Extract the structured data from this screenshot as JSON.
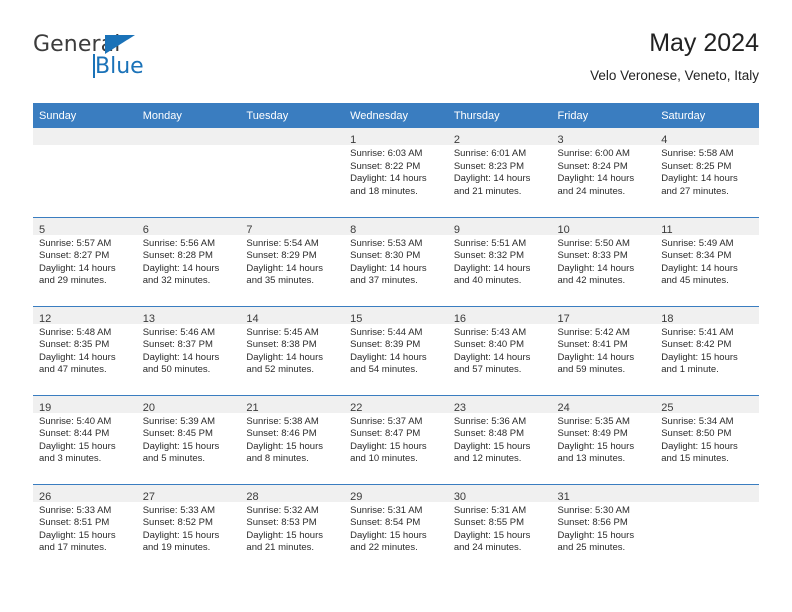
{
  "brand": {
    "name_top": "General",
    "name_bottom": "Blue",
    "accent_color": "#1a72b8"
  },
  "header": {
    "title": "May 2024",
    "subtitle": "Velo Veronese, Veneto, Italy"
  },
  "theme": {
    "header_bar_color": "#3a7dc0",
    "day_band_color": "#f0f0f0",
    "text_color": "#2b2b2b"
  },
  "weekday_headers": [
    "Sunday",
    "Monday",
    "Tuesday",
    "Wednesday",
    "Thursday",
    "Friday",
    "Saturday"
  ],
  "weeks": [
    [
      {
        "day": "",
        "empty": true,
        "sunrise": "",
        "sunset": "",
        "daylight_1": "",
        "daylight_2": ""
      },
      {
        "day": "",
        "empty": true,
        "sunrise": "",
        "sunset": "",
        "daylight_1": "",
        "daylight_2": ""
      },
      {
        "day": "",
        "empty": true,
        "sunrise": "",
        "sunset": "",
        "daylight_1": "",
        "daylight_2": ""
      },
      {
        "day": "1",
        "sunrise": "Sunrise: 6:03 AM",
        "sunset": "Sunset: 8:22 PM",
        "daylight_1": "Daylight: 14 hours",
        "daylight_2": "and 18 minutes."
      },
      {
        "day": "2",
        "sunrise": "Sunrise: 6:01 AM",
        "sunset": "Sunset: 8:23 PM",
        "daylight_1": "Daylight: 14 hours",
        "daylight_2": "and 21 minutes."
      },
      {
        "day": "3",
        "sunrise": "Sunrise: 6:00 AM",
        "sunset": "Sunset: 8:24 PM",
        "daylight_1": "Daylight: 14 hours",
        "daylight_2": "and 24 minutes."
      },
      {
        "day": "4",
        "sunrise": "Sunrise: 5:58 AM",
        "sunset": "Sunset: 8:25 PM",
        "daylight_1": "Daylight: 14 hours",
        "daylight_2": "and 27 minutes."
      }
    ],
    [
      {
        "day": "5",
        "sunrise": "Sunrise: 5:57 AM",
        "sunset": "Sunset: 8:27 PM",
        "daylight_1": "Daylight: 14 hours",
        "daylight_2": "and 29 minutes."
      },
      {
        "day": "6",
        "sunrise": "Sunrise: 5:56 AM",
        "sunset": "Sunset: 8:28 PM",
        "daylight_1": "Daylight: 14 hours",
        "daylight_2": "and 32 minutes."
      },
      {
        "day": "7",
        "sunrise": "Sunrise: 5:54 AM",
        "sunset": "Sunset: 8:29 PM",
        "daylight_1": "Daylight: 14 hours",
        "daylight_2": "and 35 minutes."
      },
      {
        "day": "8",
        "sunrise": "Sunrise: 5:53 AM",
        "sunset": "Sunset: 8:30 PM",
        "daylight_1": "Daylight: 14 hours",
        "daylight_2": "and 37 minutes."
      },
      {
        "day": "9",
        "sunrise": "Sunrise: 5:51 AM",
        "sunset": "Sunset: 8:32 PM",
        "daylight_1": "Daylight: 14 hours",
        "daylight_2": "and 40 minutes."
      },
      {
        "day": "10",
        "sunrise": "Sunrise: 5:50 AM",
        "sunset": "Sunset: 8:33 PM",
        "daylight_1": "Daylight: 14 hours",
        "daylight_2": "and 42 minutes."
      },
      {
        "day": "11",
        "sunrise": "Sunrise: 5:49 AM",
        "sunset": "Sunset: 8:34 PM",
        "daylight_1": "Daylight: 14 hours",
        "daylight_2": "and 45 minutes."
      }
    ],
    [
      {
        "day": "12",
        "sunrise": "Sunrise: 5:48 AM",
        "sunset": "Sunset: 8:35 PM",
        "daylight_1": "Daylight: 14 hours",
        "daylight_2": "and 47 minutes."
      },
      {
        "day": "13",
        "sunrise": "Sunrise: 5:46 AM",
        "sunset": "Sunset: 8:37 PM",
        "daylight_1": "Daylight: 14 hours",
        "daylight_2": "and 50 minutes."
      },
      {
        "day": "14",
        "sunrise": "Sunrise: 5:45 AM",
        "sunset": "Sunset: 8:38 PM",
        "daylight_1": "Daylight: 14 hours",
        "daylight_2": "and 52 minutes."
      },
      {
        "day": "15",
        "sunrise": "Sunrise: 5:44 AM",
        "sunset": "Sunset: 8:39 PM",
        "daylight_1": "Daylight: 14 hours",
        "daylight_2": "and 54 minutes."
      },
      {
        "day": "16",
        "sunrise": "Sunrise: 5:43 AM",
        "sunset": "Sunset: 8:40 PM",
        "daylight_1": "Daylight: 14 hours",
        "daylight_2": "and 57 minutes."
      },
      {
        "day": "17",
        "sunrise": "Sunrise: 5:42 AM",
        "sunset": "Sunset: 8:41 PM",
        "daylight_1": "Daylight: 14 hours",
        "daylight_2": "and 59 minutes."
      },
      {
        "day": "18",
        "sunrise": "Sunrise: 5:41 AM",
        "sunset": "Sunset: 8:42 PM",
        "daylight_1": "Daylight: 15 hours",
        "daylight_2": "and 1 minute."
      }
    ],
    [
      {
        "day": "19",
        "sunrise": "Sunrise: 5:40 AM",
        "sunset": "Sunset: 8:44 PM",
        "daylight_1": "Daylight: 15 hours",
        "daylight_2": "and 3 minutes."
      },
      {
        "day": "20",
        "sunrise": "Sunrise: 5:39 AM",
        "sunset": "Sunset: 8:45 PM",
        "daylight_1": "Daylight: 15 hours",
        "daylight_2": "and 5 minutes."
      },
      {
        "day": "21",
        "sunrise": "Sunrise: 5:38 AM",
        "sunset": "Sunset: 8:46 PM",
        "daylight_1": "Daylight: 15 hours",
        "daylight_2": "and 8 minutes."
      },
      {
        "day": "22",
        "sunrise": "Sunrise: 5:37 AM",
        "sunset": "Sunset: 8:47 PM",
        "daylight_1": "Daylight: 15 hours",
        "daylight_2": "and 10 minutes."
      },
      {
        "day": "23",
        "sunrise": "Sunrise: 5:36 AM",
        "sunset": "Sunset: 8:48 PM",
        "daylight_1": "Daylight: 15 hours",
        "daylight_2": "and 12 minutes."
      },
      {
        "day": "24",
        "sunrise": "Sunrise: 5:35 AM",
        "sunset": "Sunset: 8:49 PM",
        "daylight_1": "Daylight: 15 hours",
        "daylight_2": "and 13 minutes."
      },
      {
        "day": "25",
        "sunrise": "Sunrise: 5:34 AM",
        "sunset": "Sunset: 8:50 PM",
        "daylight_1": "Daylight: 15 hours",
        "daylight_2": "and 15 minutes."
      }
    ],
    [
      {
        "day": "26",
        "sunrise": "Sunrise: 5:33 AM",
        "sunset": "Sunset: 8:51 PM",
        "daylight_1": "Daylight: 15 hours",
        "daylight_2": "and 17 minutes."
      },
      {
        "day": "27",
        "sunrise": "Sunrise: 5:33 AM",
        "sunset": "Sunset: 8:52 PM",
        "daylight_1": "Daylight: 15 hours",
        "daylight_2": "and 19 minutes."
      },
      {
        "day": "28",
        "sunrise": "Sunrise: 5:32 AM",
        "sunset": "Sunset: 8:53 PM",
        "daylight_1": "Daylight: 15 hours",
        "daylight_2": "and 21 minutes."
      },
      {
        "day": "29",
        "sunrise": "Sunrise: 5:31 AM",
        "sunset": "Sunset: 8:54 PM",
        "daylight_1": "Daylight: 15 hours",
        "daylight_2": "and 22 minutes."
      },
      {
        "day": "30",
        "sunrise": "Sunrise: 5:31 AM",
        "sunset": "Sunset: 8:55 PM",
        "daylight_1": "Daylight: 15 hours",
        "daylight_2": "and 24 minutes."
      },
      {
        "day": "31",
        "sunrise": "Sunrise: 5:30 AM",
        "sunset": "Sunset: 8:56 PM",
        "daylight_1": "Daylight: 15 hours",
        "daylight_2": "and 25 minutes."
      },
      {
        "day": "",
        "empty": true,
        "sunrise": "",
        "sunset": "",
        "daylight_1": "",
        "daylight_2": ""
      }
    ]
  ]
}
